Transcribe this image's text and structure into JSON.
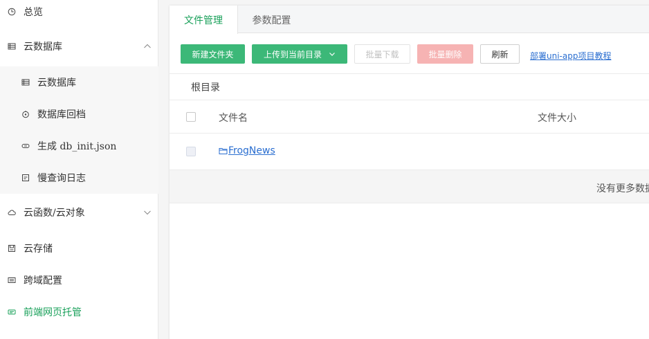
{
  "sidebar": {
    "items": [
      {
        "label": "总览",
        "icon": "dashboard-icon"
      },
      {
        "label": "云数据库",
        "icon": "database-icon",
        "expanded": true
      },
      {
        "label": "云函数/云对象",
        "icon": "cloud-icon",
        "expanded": false
      },
      {
        "label": "云存储",
        "icon": "storage-icon"
      },
      {
        "label": "跨域配置",
        "icon": "cors-icon"
      },
      {
        "label": "前端网页托管",
        "icon": "hosting-icon",
        "active": true
      }
    ],
    "sub_items": [
      {
        "label": "云数据库",
        "icon": "table-icon"
      },
      {
        "label": "数据库回档",
        "icon": "restore-icon"
      },
      {
        "label": "生成 db_init.json",
        "icon": "link-icon"
      },
      {
        "label": "慢查询日志",
        "icon": "log-icon"
      }
    ],
    "active_color": "#19a05a"
  },
  "tabs": [
    {
      "label": "文件管理",
      "active": true
    },
    {
      "label": "参数配置",
      "active": false
    }
  ],
  "toolbar": {
    "new_folder": "新建文件夹",
    "upload": "上传到当前目录",
    "batch_download": "批量下载",
    "batch_delete": "批量删除",
    "refresh": "刷新",
    "tutorial_link": "部署uni-app项目教程"
  },
  "breadcrumb": "根目录",
  "table": {
    "columns": [
      "文件名",
      "文件大小"
    ],
    "rows": [
      {
        "name": "FrogNews",
        "type": "folder",
        "size": ""
      }
    ],
    "no_more": "没有更多数据"
  },
  "colors": {
    "primary": "#3cb878",
    "danger_disabled": "#f6b3b3",
    "link": "#2a6ed0"
  }
}
